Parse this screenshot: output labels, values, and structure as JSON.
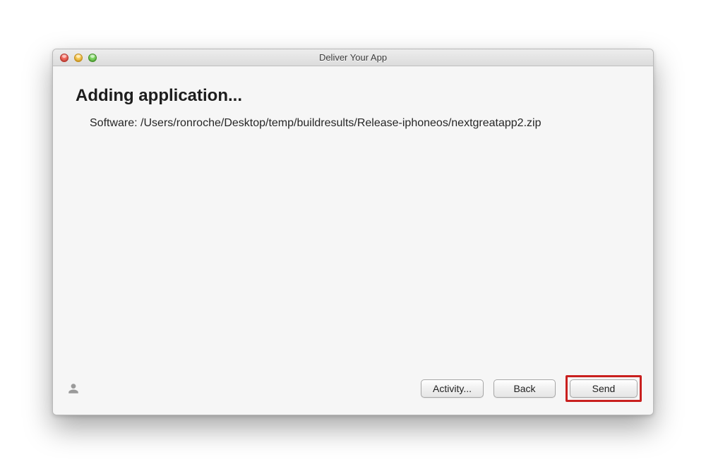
{
  "window": {
    "title": "Deliver Your App"
  },
  "content": {
    "heading": "Adding application...",
    "software_label": "Software:",
    "software_path": "/Users/ronroche/Desktop/temp/buildresults/Release-iphoneos/nextgreatapp2.zip"
  },
  "footer": {
    "activity_label": "Activity...",
    "back_label": "Back",
    "send_label": "Send"
  },
  "icons": {
    "user": "user-icon"
  },
  "colors": {
    "highlight_ring": "#c9201f"
  }
}
